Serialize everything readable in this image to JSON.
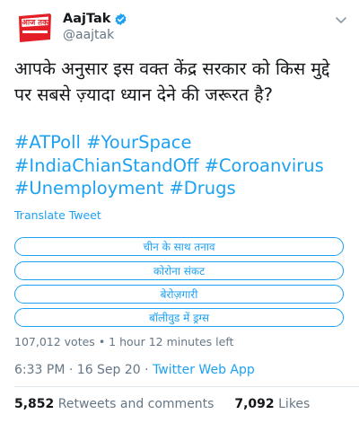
{
  "author": {
    "logo_text": "आज तक",
    "display_name": "AajTak",
    "handle": "@aajtak"
  },
  "tweet": {
    "text": "आपके अनुसार इस वक्त केंद्र सरकार को किस मुद्दे पर सबसे ज़्यादा ध्यान देने की जरूरत है?",
    "hashtags": [
      "#ATPoll",
      "#YourSpace",
      "#IndiaChianStandOff",
      "#Coroanvirus",
      "#Unemployment",
      "#Drugs"
    ],
    "translate_label": "Translate Tweet"
  },
  "poll": {
    "options": [
      "चीन के साथ तनाव",
      "कोरोना संकट",
      "बेरोज़गारी",
      "बॉलीवुड में ड्रग्स"
    ],
    "votes": "107,012 votes",
    "separator": "•",
    "time_left": "1 hour 12 minutes left"
  },
  "meta": {
    "time": "6:33 PM",
    "date": "16 Sep 20",
    "separator": "·",
    "source": "Twitter Web App"
  },
  "stats": {
    "retweets_count": "5,852",
    "retweets_label": "Retweets and comments",
    "likes_count": "7,092",
    "likes_label": "Likes"
  },
  "colors": {
    "accent": "#1da1f2",
    "logo_red": "#e41e26",
    "muted": "#657786"
  },
  "icons": {
    "verified": "verified-badge-icon",
    "menu": "chevron-down-icon"
  }
}
